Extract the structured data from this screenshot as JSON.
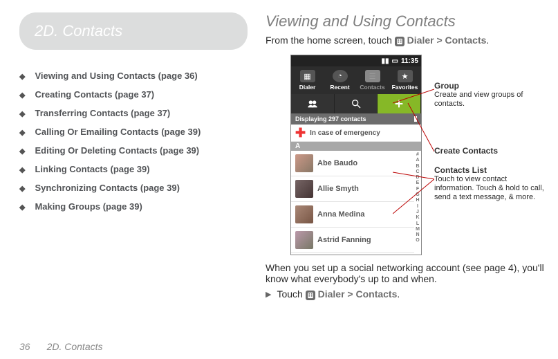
{
  "chapter": {
    "label": "2D. Contacts"
  },
  "toc": {
    "items": [
      {
        "label": "Viewing and Using Contacts (page 36)"
      },
      {
        "label": "Creating Contacts (page 37)"
      },
      {
        "label": "Transferring Contacts (page 37)"
      },
      {
        "label": "Calling Or Emailing Contacts (page 39)"
      },
      {
        "label": "Editing Or Deleting Contacts (page 39)"
      },
      {
        "label": "Linking Contacts (page 39)"
      },
      {
        "label": "Synchronizing Contacts (page 39)"
      },
      {
        "label": "Making Groups (page 39)"
      }
    ]
  },
  "heading": "Viewing and Using Contacts",
  "intro_a": "From the home screen, touch ",
  "intro_b": " Dialer > Contacts",
  "intro_c": ".",
  "device": {
    "time": "11:35",
    "tabs": {
      "dialer": "Dialer",
      "recent": "Recent",
      "contacts": "Contacts",
      "favorites": "Favorites"
    },
    "count": "Displaying 297 contacts",
    "emergency": "In case of emergency",
    "section": "A",
    "contacts": [
      {
        "name": "Abe Baudo"
      },
      {
        "name": "Allie Smyth"
      },
      {
        "name": "Anna Medina"
      },
      {
        "name": "Astrid Fanning"
      }
    ],
    "index": [
      "#",
      "A",
      "B",
      "C",
      "D",
      "E",
      "F",
      "G",
      "H",
      "I",
      "J",
      "K",
      "L",
      "M",
      "N",
      "O"
    ]
  },
  "callouts": {
    "group": {
      "title": "Group",
      "desc": "Create and view groups of contacts."
    },
    "create": {
      "title": "Create Contacts"
    },
    "list": {
      "title": "Contacts  List",
      "desc": "Touch to view contact information. Touch & hold to call, send a text message, & more."
    }
  },
  "outro": "When you set up a social networking account (see page 4), you'll know what everybody's up to and when.",
  "outro2_a": "Touch ",
  "outro2_b": " Dialer > Contacts",
  "outro2_c": ".",
  "footer": {
    "page": "36",
    "title": "2D. Contacts"
  }
}
